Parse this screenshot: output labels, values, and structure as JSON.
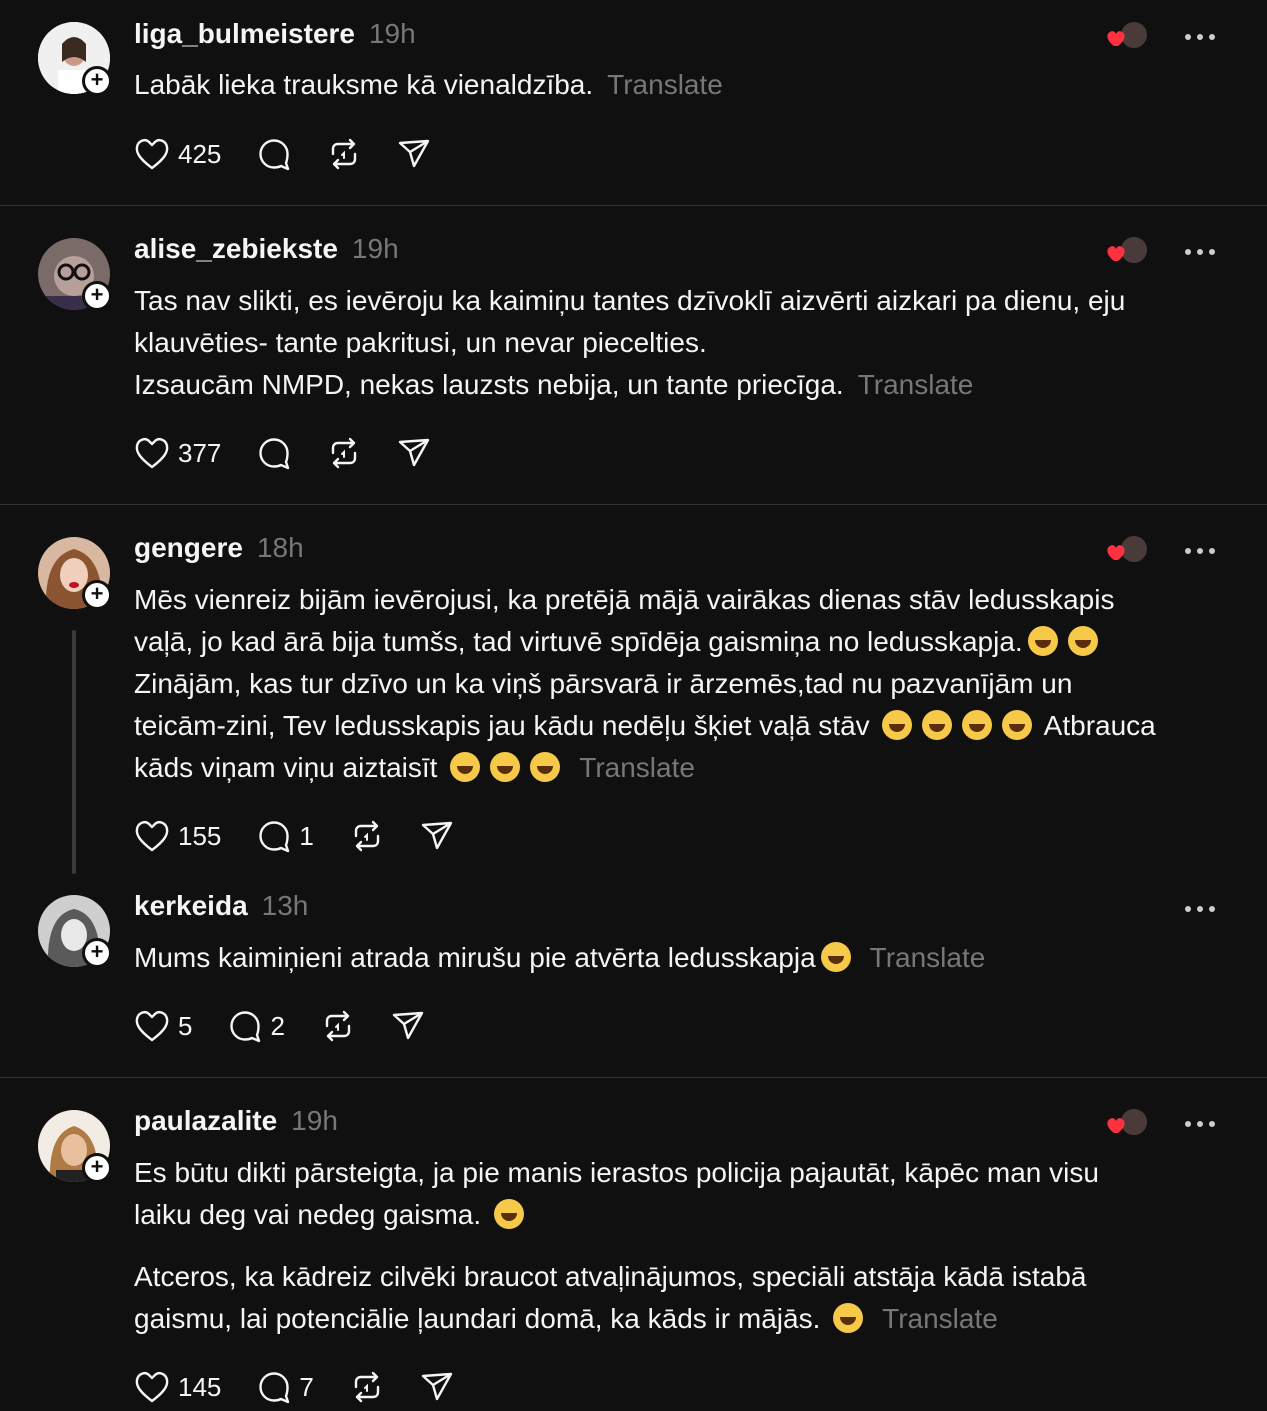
{
  "posts": [
    {
      "username": "liga_bulmeistere",
      "time": "19h",
      "lines": [
        "Labāk lieka trauksme kā vienaldzība."
      ],
      "translate": "Translate",
      "likes": "425",
      "replies": "",
      "liked_by_icon": "heart-with-avatar-icon"
    },
    {
      "username": "alise_zebiekste",
      "time": "19h",
      "lines": [
        "Tas nav slikti, es ievēroju ka kaimiņu tantes dzīvoklī aizvērti aizkari pa dienu, eju",
        "klauvēties- tante pakritusi, un nevar piecelties.",
        "Izsaucām NMPD, nekas lauzsts nebija, un tante priecīga."
      ],
      "translate": "Translate",
      "likes": "377",
      "replies": ""
    },
    {
      "username": "gengere",
      "time": "18h",
      "lines": [
        "Mēs vienreiz bijām ievērojusi, ka pretējā mājā vairākas dienas stāv ledusskapis",
        "vaļā, jo kad ārā bija tumšs, tad virtuvē spīdēja gaismiņa no ledusskapja.",
        "Zinājām, kas tur dzīvo un ka viņš pārsvarā ir ārzemēs,tad nu pazvanījām un",
        "teicām-zini, Tev ledusskapis jau kādu nedēļu šķiet vaļā stāv",
        "Atbrauca",
        "kāds viņam viņu aiztaisīt"
      ],
      "translate": "Translate",
      "likes": "155",
      "replies": "1"
    },
    {
      "username": "kerkeida",
      "time": "13h",
      "lines": [
        "Mums kaimiņieni atrada mirušu pie atvērta ledusskapja"
      ],
      "translate": "Translate",
      "likes": "5",
      "replies": "2"
    },
    {
      "username": "paulazalite",
      "time": "19h",
      "lines": [
        "Es būtu dikti pārsteigta, ja pie manis ierastos policija pajautāt, kāpēc man visu",
        "laiku deg vai nedeg gaisma.",
        "Atceros, ka kādreiz cilvēki braucot atvaļinājumos, speciāli atstāja kādā istabā",
        "gaismu, lai potenciālie ļaundari domā, ka kāds ir mājās."
      ],
      "translate": "Translate",
      "likes": "145",
      "replies": "7"
    }
  ],
  "icons": {
    "like": "heart-icon",
    "reply": "comment-icon",
    "repost": "repost-icon",
    "share": "send-icon",
    "more": "more-dots-icon",
    "follow": "plus-icon"
  },
  "colors": {
    "background": "#101010",
    "text": "#f3f5f7",
    "muted": "#777777",
    "divider": "#323232",
    "heart": "#ff3040"
  }
}
